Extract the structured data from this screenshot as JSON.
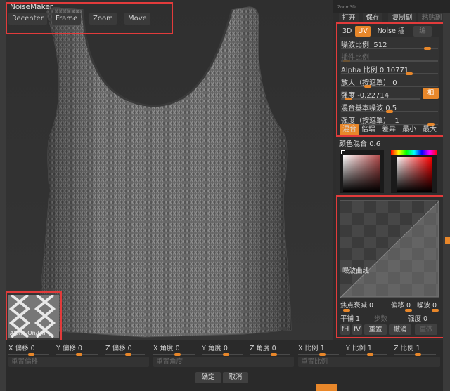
{
  "noisemaker": {
    "title": "NoiseMaker",
    "recenter": "Recenter",
    "frame": "Frame",
    "zoom": "Zoom",
    "move": "Move"
  },
  "topright": {
    "zoom3d": "Zoom3D",
    "open": "打开",
    "save": "保存",
    "copy": "复制副本",
    "paste": "粘贴副"
  },
  "tabs": {
    "t3d": "3D",
    "uv": "UV",
    "noise": "Noise 插件",
    "edit": "编辑"
  },
  "params": {
    "noise_scale": {
      "label": "噪波比例",
      "value": "512",
      "level": 0.92
    },
    "strength_scale": {
      "label": "插件比例",
      "value": "",
      "level": 0.02
    },
    "alpha_scale": {
      "label": "Alpha 比例",
      "value": "0.10771",
      "level": 0.72
    },
    "magnify": {
      "label": "放大（按遮罩）",
      "value": "0",
      "level": 0.26
    },
    "strength": {
      "label": "强度",
      "value": "-0.22714",
      "level": 0.06
    },
    "relative": "相对",
    "blend_base": {
      "label": "混合基本噪波",
      "value": "0.5",
      "level": 0.5
    },
    "intensity_mask": {
      "label": "强度（按遮罩）",
      "value": "1",
      "level": 0.96
    }
  },
  "blend_modes": [
    "混合",
    "倍增",
    "差异",
    "最小",
    "最大"
  ],
  "color_blend": {
    "label": "颜色混合",
    "value": "0.6"
  },
  "curve": {
    "label": "噪波曲线",
    "focal_falloff": {
      "label": "焦点衰减",
      "value": "0"
    },
    "offset": {
      "label": "偏移",
      "value": "0"
    },
    "noise": {
      "label": "噪波",
      "value": "0"
    },
    "smooth": {
      "label": "平铺",
      "value": "1"
    },
    "steps": "步数",
    "intensity": {
      "label": "强度",
      "value": "0"
    },
    "fh": "fH",
    "fv": "fV",
    "reset": "重置",
    "undo": "撤消",
    "redo": "重做"
  },
  "alpha": {
    "label": "Alpha On/Off"
  },
  "bottom": {
    "x_offset": {
      "label": "X 偏移",
      "value": "0"
    },
    "y_offset": {
      "label": "Y 偏移",
      "value": "0"
    },
    "z_offset": {
      "label": "Z 偏移",
      "value": "0"
    },
    "x_angle": {
      "label": "X 角度",
      "value": "0"
    },
    "y_angle": {
      "label": "Y 角度",
      "value": "0"
    },
    "z_angle": {
      "label": "Z 角度",
      "value": "0"
    },
    "x_scale": {
      "label": "X 比例",
      "value": "1"
    },
    "y_scale": {
      "label": "Y 比例",
      "value": "1"
    },
    "z_scale": {
      "label": "Z 比例",
      "value": "1"
    },
    "reset_offset": "重置偏移",
    "reset_angle": "重置角度",
    "reset_scale": "重置比例",
    "ok": "确定",
    "cancel": "取消"
  },
  "colors": {
    "accent": "#e8872a",
    "highlight_box": "#e23b3b"
  }
}
